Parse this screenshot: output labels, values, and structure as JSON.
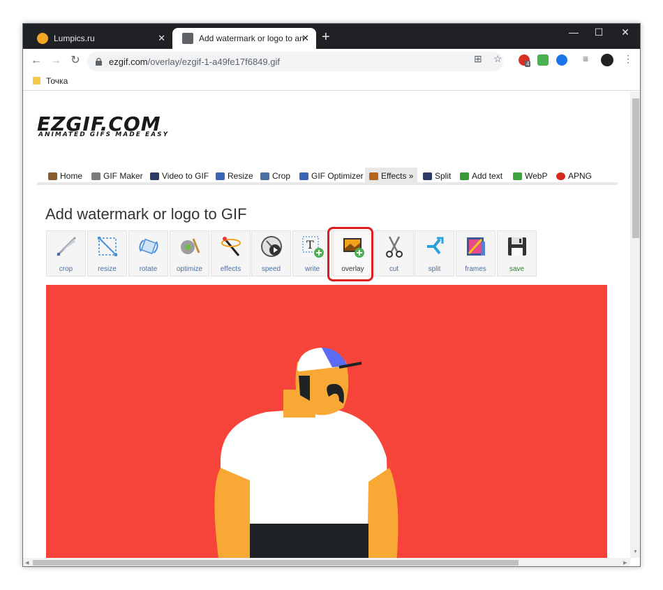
{
  "browser": {
    "tabs": [
      {
        "title": "Lumpics.ru",
        "favicon_color": "#f5a623",
        "close": "✕"
      },
      {
        "title": "Add watermark or logo to anima",
        "favicon_color": "#5f6368",
        "close": "✕"
      }
    ],
    "new_tab": "+",
    "window_controls": {
      "minimize": "—",
      "maximize": "☐",
      "close": "✕"
    },
    "nav": {
      "back": "←",
      "forward": "→",
      "reload": "↻"
    },
    "url_host": "ezgif.com",
    "url_path": "/overlay/ezgif-1-a49fe17f6849.gif",
    "extension_badge": "4",
    "bookmark": "Точка"
  },
  "site": {
    "logo_main": "EZGIF.COM",
    "logo_tagline": "ANIMATED GIFS MADE EASY",
    "menu": [
      {
        "label": "Home",
        "icon": "home-icon",
        "color": "#8b5a2b"
      },
      {
        "label": "GIF Maker",
        "icon": "film-icon",
        "color": "#7a7a7a"
      },
      {
        "label": "Video to GIF",
        "icon": "video-icon",
        "color": "#2b3b66"
      },
      {
        "label": "Resize",
        "icon": "resize-icon",
        "color": "#3a66b8"
      },
      {
        "label": "Crop",
        "icon": "crop-icon",
        "color": "#4a6fa5"
      },
      {
        "label": "GIF Optimizer",
        "icon": "optimizer-icon",
        "color": "#3a66b8"
      },
      {
        "label": "Effects »",
        "icon": "effects-icon",
        "color": "#b5651d"
      },
      {
        "label": "Split",
        "icon": "split-icon",
        "color": "#2b3b66"
      },
      {
        "label": "Add text",
        "icon": "text-icon",
        "color": "#3a9a3a"
      },
      {
        "label": "WebP",
        "icon": "webp-icon",
        "color": "#3ea33e"
      },
      {
        "label": "APNG",
        "icon": "apng-icon",
        "color": "#d62b1f"
      }
    ],
    "page_title": "Add watermark or logo to GIF",
    "tools": [
      {
        "label": "crop",
        "icon": "crop-tool-icon"
      },
      {
        "label": "resize",
        "icon": "resize-tool-icon"
      },
      {
        "label": "rotate",
        "icon": "rotate-tool-icon"
      },
      {
        "label": "optimize",
        "icon": "optimize-tool-icon"
      },
      {
        "label": "effects",
        "icon": "effects-tool-icon"
      },
      {
        "label": "speed",
        "icon": "speed-tool-icon"
      },
      {
        "label": "write",
        "icon": "write-tool-icon"
      },
      {
        "label": "overlay",
        "icon": "overlay-tool-icon"
      },
      {
        "label": "cut",
        "icon": "cut-tool-icon"
      },
      {
        "label": "split",
        "icon": "split-tool-icon"
      },
      {
        "label": "frames",
        "icon": "frames-tool-icon"
      },
      {
        "label": "save",
        "icon": "save-tool-icon"
      }
    ],
    "highlighted_tool": "overlay",
    "colors": {
      "canvas_bg": "#f6443a",
      "highlight": "#d81e1e",
      "tool_label": "#4a6fa5",
      "save_label": "#2e7d32"
    }
  }
}
